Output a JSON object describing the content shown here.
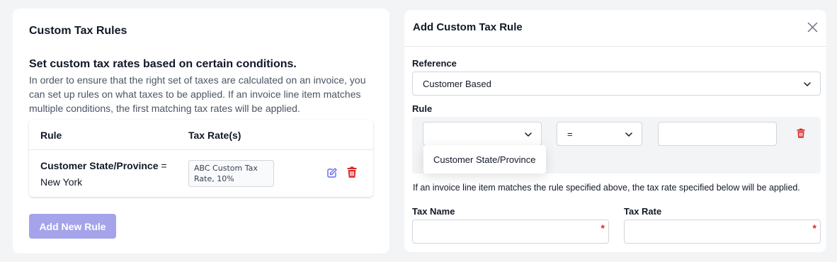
{
  "left_panel": {
    "title": "Custom Tax Rules",
    "heading": "Set custom tax rates based on certain conditions.",
    "description": "In order to ensure that the right set of taxes are calculated on an invoice, you can set up rules on what taxes to be applied. If an invoice line item matches multiple conditions, the first matching tax rates will be applied.",
    "table": {
      "columns": [
        "Rule",
        "Tax Rate(s)"
      ],
      "rows": [
        {
          "rule_field": "Customer State/Province",
          "rule_operator": "=",
          "rule_value": "New York",
          "tax_rate": "ABC Custom Tax Rate, 10%"
        }
      ]
    },
    "add_button": "Add New Rule"
  },
  "modal": {
    "title": "Add Custom Tax Rule",
    "reference_label": "Reference",
    "reference_value": "Customer Based",
    "rule_label": "Rule",
    "rule_field_value": "",
    "rule_operator_value": "=",
    "rule_value": "",
    "dropdown_options": [
      "Customer State/Province"
    ],
    "help_text": "If an invoice line item matches the rule specified above, the tax rate specified below will be applied.",
    "tax_name_label": "Tax Name",
    "tax_rate_label": "Tax Rate",
    "required_marker": "*"
  },
  "colors": {
    "accent_button": "#a5a3ea",
    "icon_edit": "#6366f1",
    "icon_delete": "#dc2626"
  },
  "icons": [
    "edit-icon",
    "trash-icon",
    "close-icon",
    "chevron-down-icon"
  ]
}
